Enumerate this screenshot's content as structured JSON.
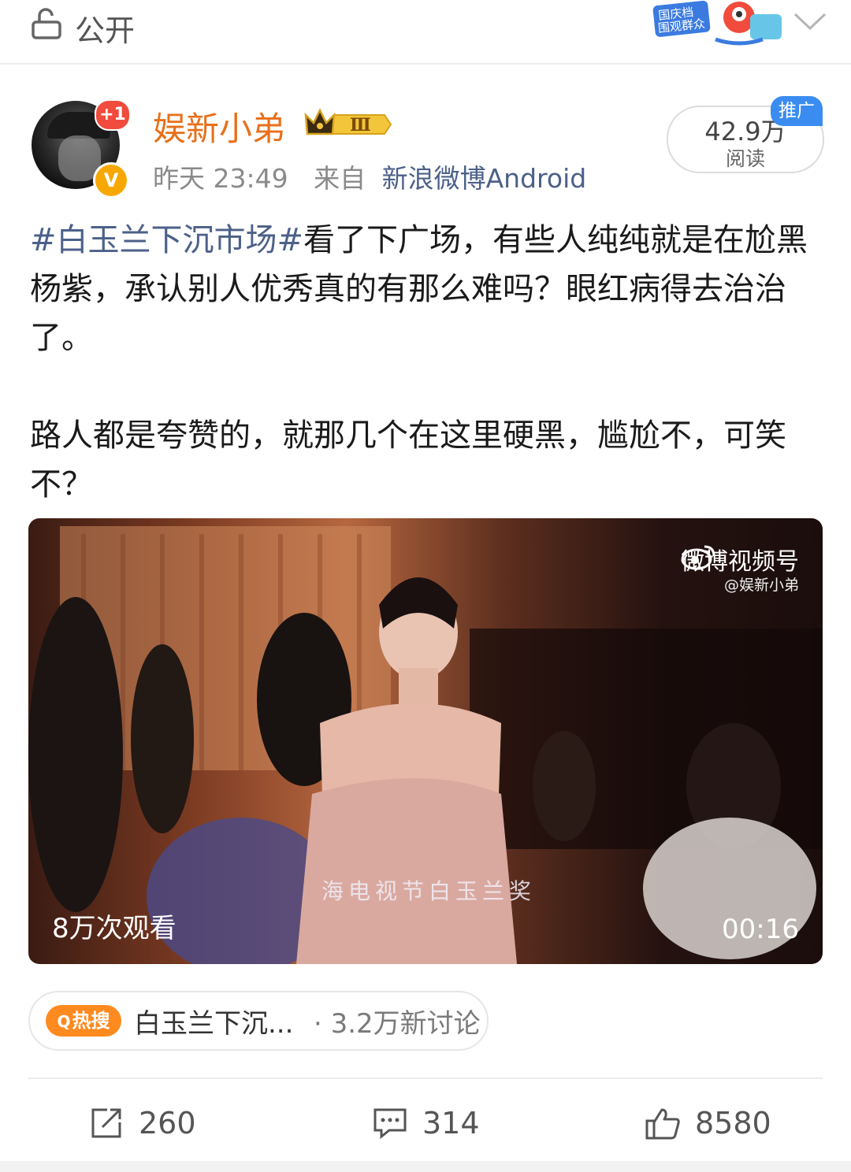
{
  "header": {
    "visibility_label": "公开",
    "promo_sticker_lines": [
      "国庆档",
      "围观群众"
    ]
  },
  "post": {
    "avatar_badge": "+1",
    "verified_mark": "V",
    "username": "娱新小弟",
    "vip_level": "Ⅲ",
    "time": "昨天 23:49",
    "source_prefix": "来自",
    "source": "新浪微博Android",
    "reads_count": "42.9万",
    "reads_label": "阅读",
    "promo_tag": "推广",
    "hashtag": "#白玉兰下沉市场#",
    "text_line1": "看了下广场，有些人纯纯就是在尬黑杨紫，承认别人优秀真的有那么难吗？眼红病得去治治了。",
    "text_para2": "路人都是夸赞的，就那几个在这里硬黑，尴尬不，可笑不？"
  },
  "video": {
    "brand": "微博视频号",
    "handle": "@娱新小弟",
    "views": "8万次观看",
    "duration": "00:16",
    "caption": "海电视节白玉兰奖"
  },
  "hot_search": {
    "tag": "热搜",
    "title": "白玉兰下沉...",
    "meta": "· 3.2万新讨论"
  },
  "actions": {
    "repost_count": "260",
    "comment_count": "314",
    "like_count": "8580"
  },
  "colors": {
    "username": "#e8701a",
    "link": "#4c6189",
    "hot_tag": "#ff8a1f",
    "promo_tag": "#3a8cf0",
    "badge_red": "#f04b3c",
    "verified": "#f7a800"
  }
}
